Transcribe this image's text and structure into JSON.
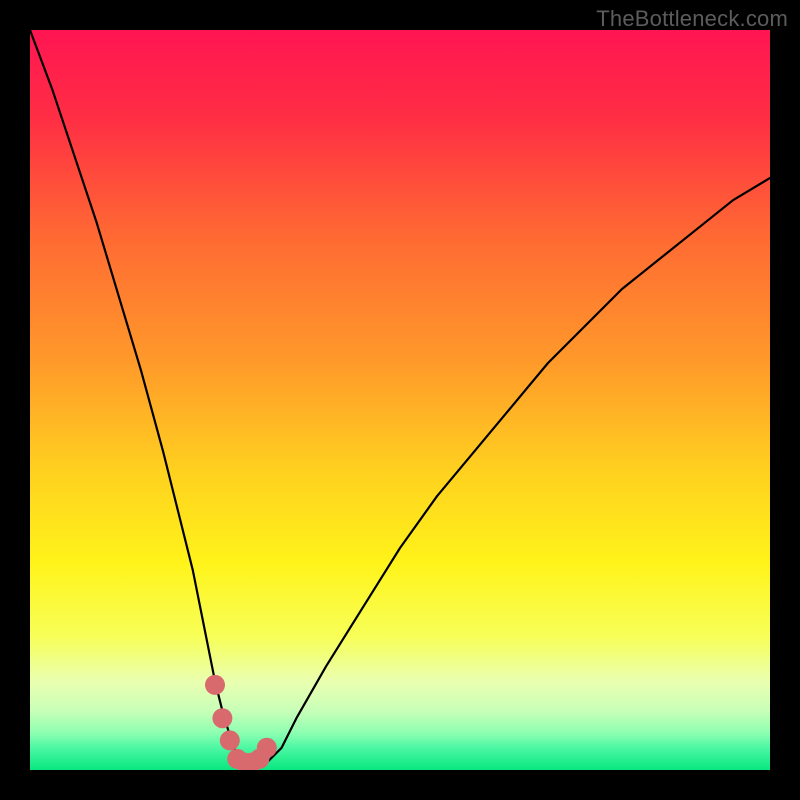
{
  "watermark": "TheBottleneck.com",
  "colors": {
    "background": "#000000",
    "watermark": "#5c5c5c",
    "curve": "#000000",
    "marker_fill": "#d86a6e",
    "marker_stroke": "#b24d51",
    "gradient_stops": [
      {
        "offset": "0%",
        "color": "#ff1552"
      },
      {
        "offset": "12%",
        "color": "#ff2e44"
      },
      {
        "offset": "28%",
        "color": "#ff6a33"
      },
      {
        "offset": "45%",
        "color": "#ff9a2a"
      },
      {
        "offset": "60%",
        "color": "#ffd21f"
      },
      {
        "offset": "72%",
        "color": "#fff31a"
      },
      {
        "offset": "82%",
        "color": "#f7ff58"
      },
      {
        "offset": "88%",
        "color": "#eaffb0"
      },
      {
        "offset": "92%",
        "color": "#c8ffb8"
      },
      {
        "offset": "95%",
        "color": "#8dffb1"
      },
      {
        "offset": "97%",
        "color": "#4cf7a3"
      },
      {
        "offset": "100%",
        "color": "#08e77f"
      }
    ]
  },
  "chart_data": {
    "type": "line",
    "title": "",
    "xlabel": "",
    "ylabel": "",
    "xlim": [
      0,
      100
    ],
    "ylim": [
      0,
      100
    ],
    "series": [
      {
        "name": "curve",
        "x": [
          0,
          3,
          6,
          9,
          12,
          15,
          18,
          20,
          22,
          24,
          25,
          26,
          27.5,
          29,
          30,
          31,
          32,
          34,
          36,
          40,
          45,
          50,
          55,
          60,
          65,
          70,
          75,
          80,
          85,
          90,
          95,
          100
        ],
        "values": [
          100,
          92,
          83,
          74,
          64,
          54,
          43,
          35,
          27,
          17,
          12,
          8,
          3,
          1,
          0.5,
          0.5,
          1,
          3,
          7,
          14,
          22,
          30,
          37,
          43,
          49,
          55,
          60,
          65,
          69,
          73,
          77,
          80
        ]
      }
    ],
    "markers": {
      "name": "bottom-markers",
      "x": [
        25,
        26,
        27,
        28,
        29,
        30,
        31,
        32
      ],
      "values": [
        11.5,
        7,
        4,
        1.5,
        1,
        1,
        1.5,
        3
      ]
    }
  }
}
